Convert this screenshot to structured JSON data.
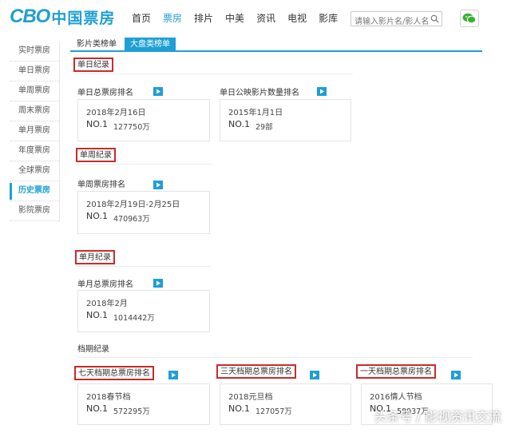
{
  "header": {
    "logo_latin": "CBO",
    "logo_cn": "中国票房",
    "nav": [
      "首页",
      "票房",
      "排片",
      "中美",
      "资讯",
      "电视",
      "影库"
    ],
    "active_nav": "票房",
    "search_placeholder": "请输入影片名/影人名称"
  },
  "sidebar": {
    "items": [
      "实时票房",
      "单日票房",
      "单周票房",
      "周末票房",
      "单月票房",
      "年度票房",
      "全球票房",
      "历史票房",
      "影院票房"
    ],
    "active": "历史票房"
  },
  "tabs": [
    "影片类榜单",
    "大盘类榜单"
  ],
  "sections": {
    "daily": {
      "title": "单日纪录",
      "cards": [
        {
          "label": "单日总票房排名",
          "date": "2018年2月16日",
          "rank": "NO.1",
          "value": "127750万"
        },
        {
          "label": "单日公映影片数量排名",
          "date": "2015年1月1日",
          "rank": "NO.1",
          "value": "29部"
        }
      ]
    },
    "weekly": {
      "title": "单周纪录",
      "cards": [
        {
          "label": "单周票房排名",
          "date": "2018年2月19日-2月25日",
          "rank": "NO.1",
          "value": "470963万"
        }
      ]
    },
    "monthly": {
      "title": "单月纪录",
      "cards": [
        {
          "label": "单月总票房排名",
          "date": "2018年2月",
          "rank": "NO.1",
          "value": "1014442万"
        }
      ]
    },
    "schedule": {
      "title": "档期纪录",
      "cards": [
        {
          "label": "七天档期总票房排名",
          "date": "2018春节档",
          "rank": "NO.1",
          "value": "572295万"
        },
        {
          "label": "三天档期总票房排名",
          "date": "2018元旦档",
          "rank": "NO.1",
          "value": "127057万"
        },
        {
          "label": "一天档期总票房排名",
          "date": "2016情人节档",
          "rank": "NO.1",
          "value": "58937万"
        }
      ]
    }
  },
  "watermark": "头条号 / 影视资讯交流",
  "colors": {
    "accent": "#1f9fd4",
    "highlight_border": "#cc2a2a",
    "play_icon": "#1f9fd4"
  }
}
